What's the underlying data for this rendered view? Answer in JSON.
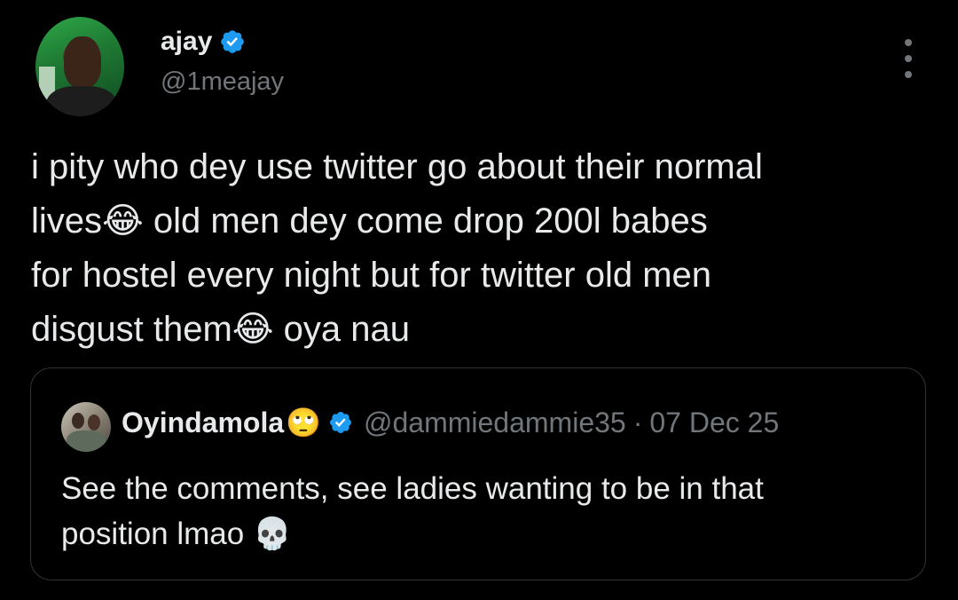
{
  "author": {
    "display_name": "ajay",
    "handle": "@1meajay",
    "verified": true
  },
  "tweet": {
    "lines": [
      {
        "text": "i pity who dey use twitter go about their normal",
        "emoji": ""
      },
      {
        "text": "lives",
        "emoji": "😂",
        "after": " old men dey come drop 200l babes"
      },
      {
        "text": "for hostel every night but for twitter old men",
        "emoji": ""
      },
      {
        "text": "disgust them",
        "emoji": "😂",
        "after": " oya nau"
      }
    ]
  },
  "quoted": {
    "display_name": "Oyindamola",
    "name_emoji": "🙄",
    "verified": true,
    "handle": "@dammiedammie35",
    "separator": "·",
    "date": "07 Dec 25",
    "lines": [
      "See the comments, see ladies wanting to be in that",
      "position lmao"
    ],
    "trailing_emoji": "💀"
  },
  "icons": {
    "verified": "verified-badge-icon",
    "more": "more-options-icon"
  },
  "colors": {
    "background": "#000000",
    "text": "#e7e9ea",
    "secondary": "#71767b",
    "verified_blue": "#1d9bf0",
    "border": "#2f3336"
  }
}
